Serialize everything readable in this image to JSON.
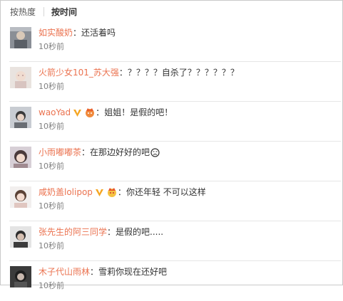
{
  "sort": {
    "hot_label": "按热度",
    "time_label": "按时间"
  },
  "comments": [
    {
      "user": "如实酸奶",
      "text": "还活着吗",
      "time": "10秒前",
      "avatar_icon": "photo-avatar-icon"
    },
    {
      "user": "火箭少女101_苏大强",
      "text": "？？？？自杀了？？？？？？",
      "time": "10秒前",
      "avatar_icon": "photo-avatar-icon"
    },
    {
      "user": "waoYad",
      "text": "姐姐！是假的吧！",
      "time": "10秒前",
      "avatar_icon": "photo-avatar-icon",
      "badges": [
        "vip-v-badge-icon",
        "member-crown-icon"
      ]
    },
    {
      "user": "小雨嘟嘟茶",
      "text": "在那边好好的吧",
      "time": "10秒前",
      "avatar_icon": "photo-avatar-icon",
      "trailing_emoji": "crying-emoji-icon"
    },
    {
      "user": "咸奶盖lolipop",
      "text": "你还年轻 不可以这样",
      "time": "10秒前",
      "avatar_icon": "photo-avatar-icon",
      "badges": [
        "vip-v-badge-icon",
        "member-crown-icon"
      ]
    },
    {
      "user": "张先生的阿三同学",
      "text": "是假的吧.....",
      "time": "10秒前",
      "avatar_icon": "photo-avatar-icon"
    },
    {
      "user": "木子代山雨林",
      "text": "雪莉你现在还好吧",
      "time": "10秒前",
      "avatar_icon": "photo-avatar-icon"
    }
  ],
  "colors": {
    "username": "#eb7350",
    "text": "#333333",
    "time": "#808080",
    "vip_badge": "#f5a623"
  }
}
